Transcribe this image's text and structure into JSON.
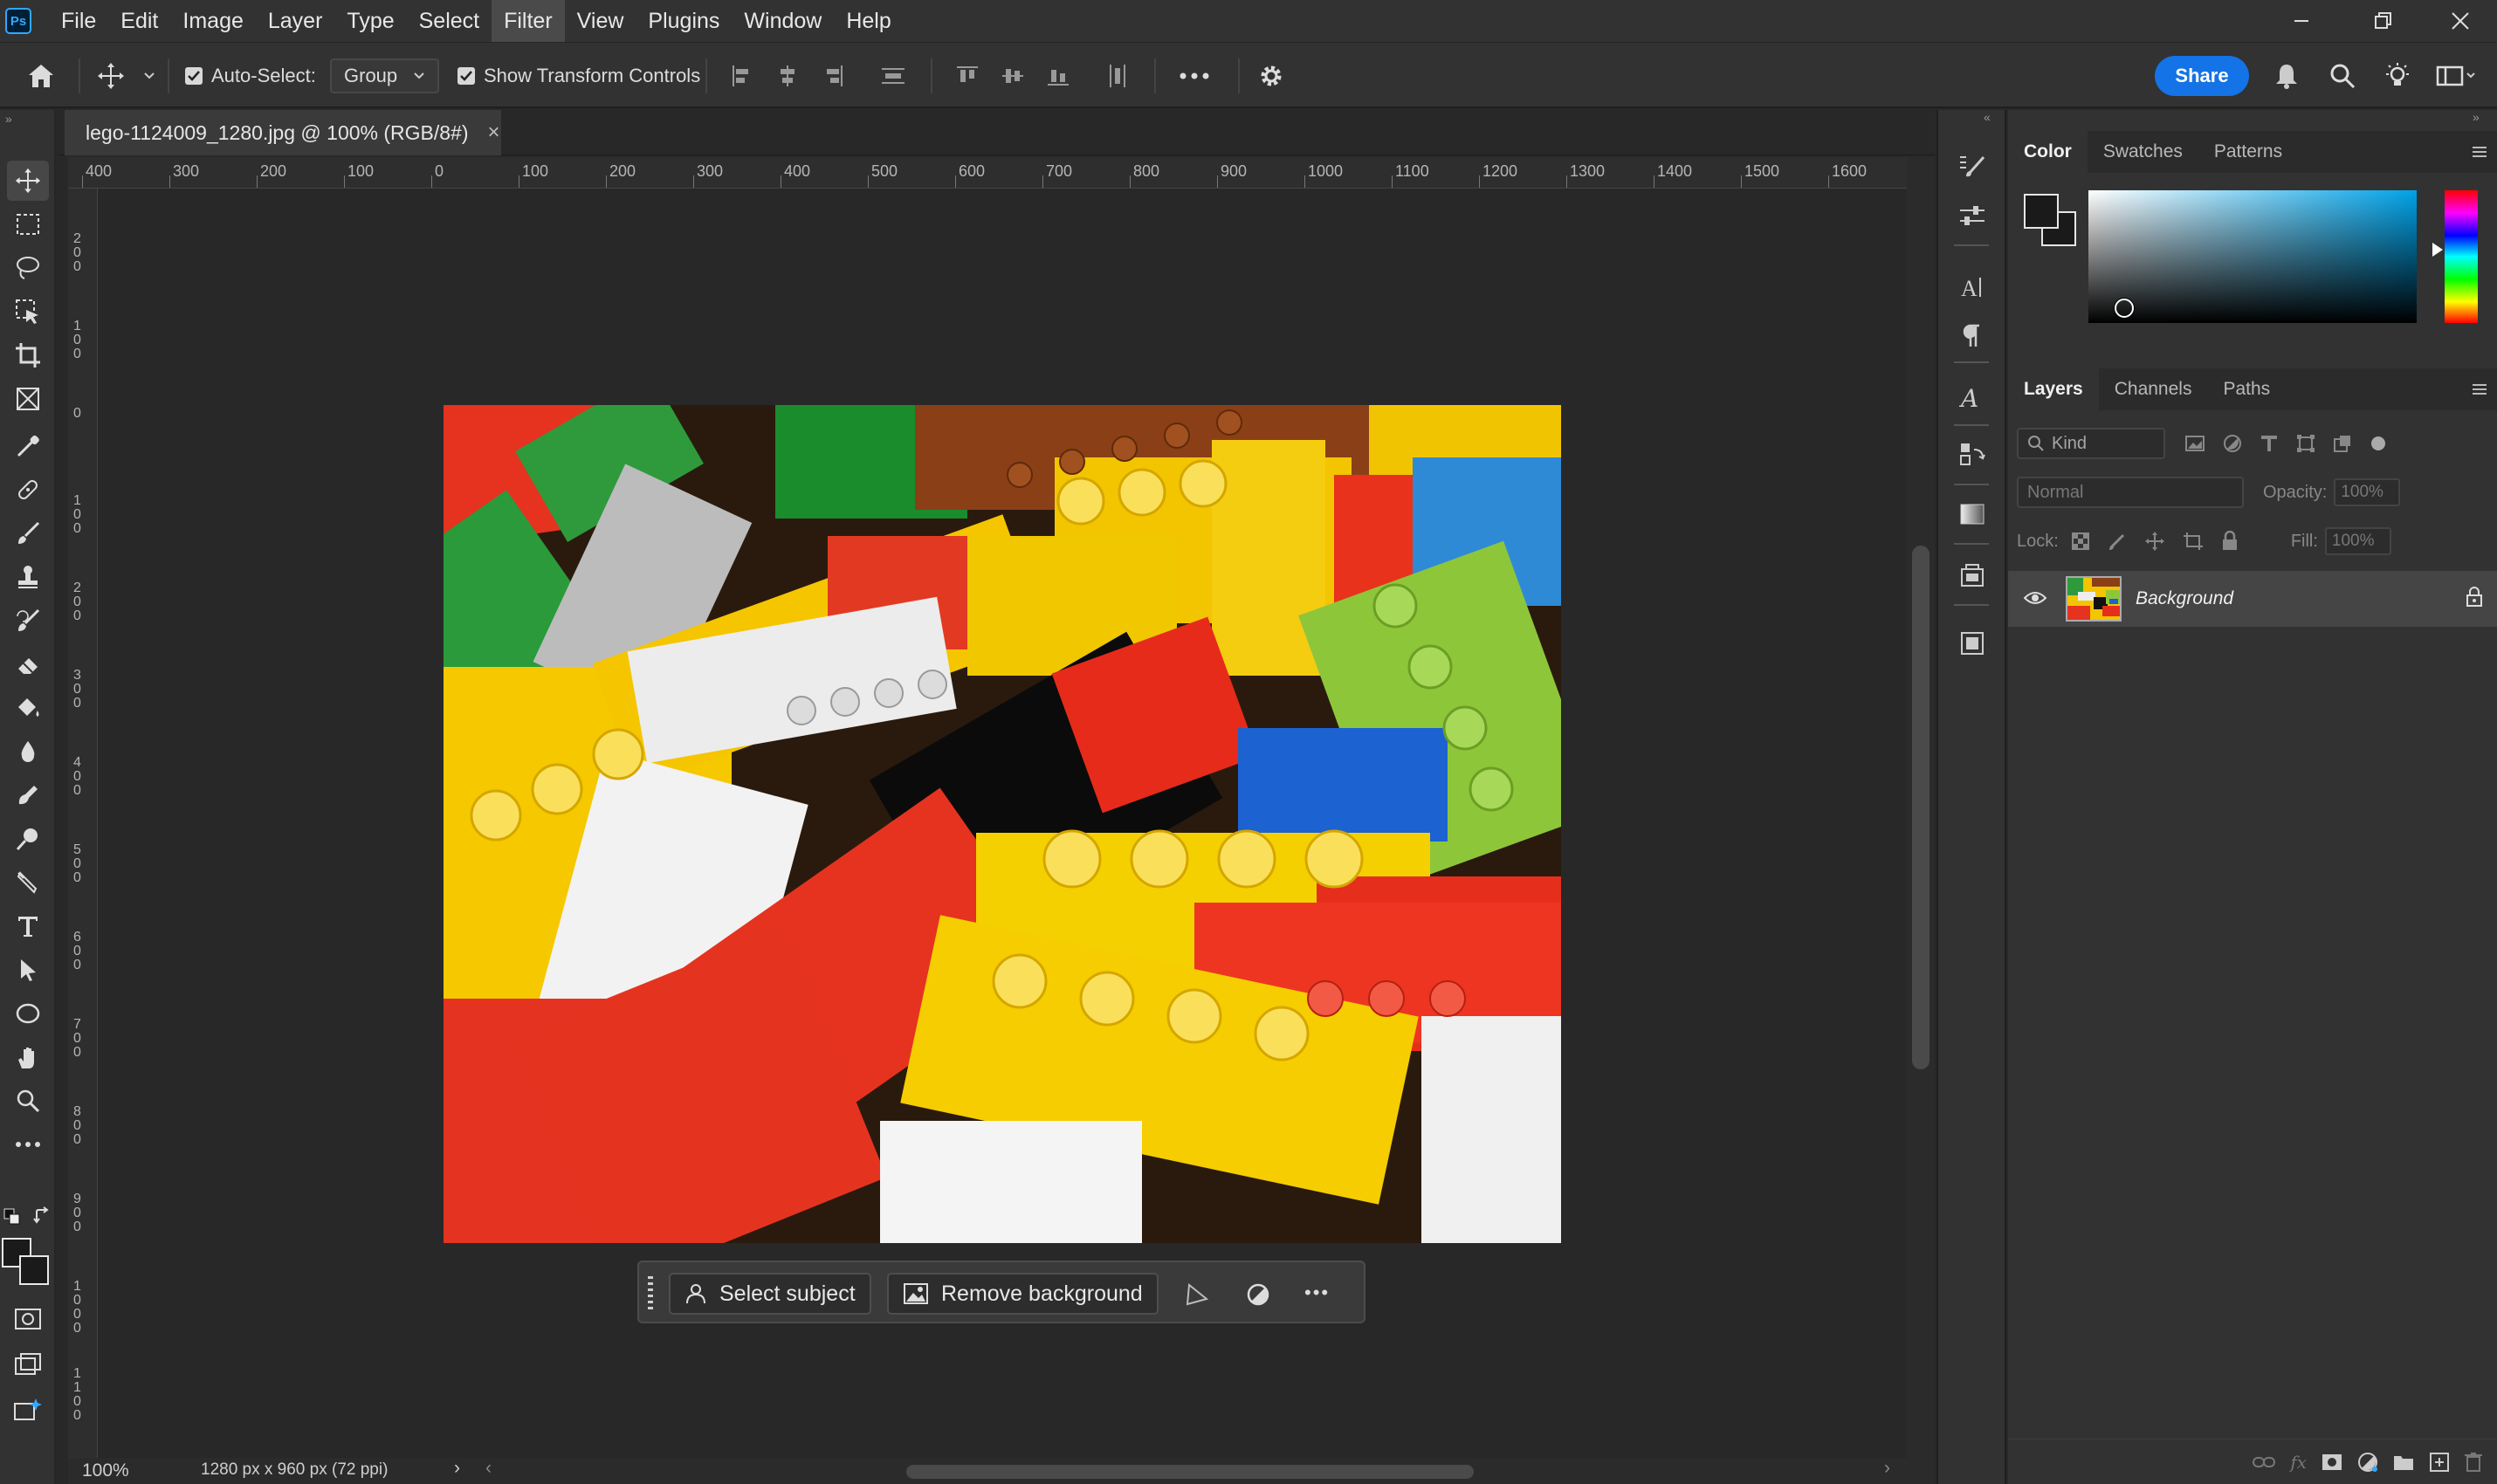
{
  "app": {
    "logo_text": "Ps"
  },
  "menu": [
    "File",
    "Edit",
    "Image",
    "Layer",
    "Type",
    "Select",
    "Filter",
    "View",
    "Plugins",
    "Window",
    "Help"
  ],
  "options": {
    "auto_select_label": "Auto-Select:",
    "auto_select_checked": true,
    "auto_select_mode": "Group",
    "show_transform_label": "Show Transform Controls",
    "show_transform_checked": true,
    "share_label": "Share"
  },
  "document": {
    "tab_title": "lego-1124009_1280.jpg @ 100% (RGB/8#)",
    "close_glyph": "×"
  },
  "rulers": {
    "horizontal": [
      "400",
      "300",
      "200",
      "100",
      "0",
      "100",
      "200",
      "300",
      "400",
      "500",
      "600",
      "700",
      "800",
      "900",
      "1000",
      "1100",
      "1200",
      "1300",
      "1400",
      "1500",
      "1600"
    ],
    "vertical": [
      "200",
      "100",
      "0",
      "100",
      "200",
      "300",
      "400",
      "500",
      "600",
      "700",
      "800",
      "900",
      "1000",
      "1100"
    ]
  },
  "status": {
    "zoom": "100%",
    "doc_info": "1280 px x 960 px (72 ppi)",
    "arrow": "›",
    "left_arrow": "‹",
    "right_arrow": "›"
  },
  "taskbar": {
    "select_subject": "Select subject",
    "remove_background": "Remove background",
    "more_glyph": "•••"
  },
  "color_panel": {
    "tabs": [
      "Color",
      "Swatches",
      "Patterns"
    ],
    "active_tab": "Color",
    "foreground": "#1a1a1a",
    "background": "#1a1a1a",
    "field_hue": "#00a2e8"
  },
  "layers_panel": {
    "tabs": [
      "Layers",
      "Channels",
      "Paths"
    ],
    "active_tab": "Layers",
    "filter_kind": "Kind",
    "blend_mode": "Normal",
    "opacity_label": "Opacity:",
    "opacity_value": "100%",
    "lock_label": "Lock:",
    "fill_label": "Fill:",
    "fill_value": "100%",
    "layers": [
      {
        "name": "Background",
        "visible": true,
        "locked": true
      }
    ]
  }
}
